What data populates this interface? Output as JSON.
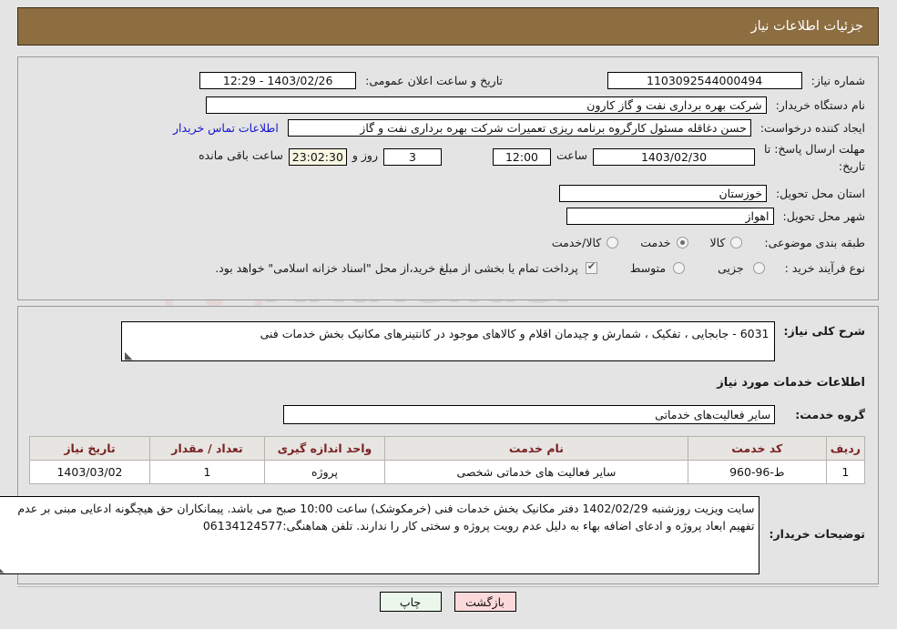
{
  "header": {
    "title": "جزئیات اطلاعات نیاز"
  },
  "form": {
    "need_number_label": "شماره نیاز:",
    "need_number_value": "1103092544000494",
    "announce_label": "تاریخ و ساعت اعلان عمومی:",
    "announce_value": "1403/02/26 - 12:29",
    "buyer_org_label": "نام دستگاه خریدار:",
    "buyer_org_value": "شرکت بهره برداری نفت و گاز کارون",
    "creator_label": "ایجاد کننده درخواست:",
    "creator_value": "حسن دغاقله مسئول کارگروه برنامه ریزی تعمیرات شرکت بهره برداری نفت و گاز",
    "contact_link": "اطلاعات تماس خریدار",
    "deadline_label_line1": "مهلت ارسال پاسخ: تا",
    "deadline_label_line2": "تاریخ:",
    "deadline_date": "1403/02/30",
    "hour_label": "ساعت",
    "deadline_time": "12:00",
    "days_value": "3",
    "days_label": "روز و",
    "remaining_value": "23:02:30",
    "remaining_label": "ساعت باقی مانده",
    "province_label": "استان محل تحویل:",
    "province_value": "خوزستان",
    "city_label": "شهر محل تحویل:",
    "city_value": "اهواز",
    "category_label": "طبقه بندی موضوعی:",
    "category_options": [
      "کالا",
      "خدمت",
      "کالا/خدمت"
    ],
    "category_selected": "خدمت",
    "process_label": "نوع فرآیند خرید :",
    "process_options": [
      "جزیی",
      "متوسط"
    ],
    "process_selected": "جزیی",
    "payment_checkbox_checked": true,
    "payment_note": "پرداخت تمام یا بخشی از مبلغ خرید،از محل \"اسناد خزانه اسلامی\" خواهد بود."
  },
  "description": {
    "label": "شرح کلی نیاز:",
    "value": "6031 - جابجایی ، تفکیک ، شمارش و چیدمان اقلام و کالاهای موجود در کانتینرهای مکانیک بخش خدمات فنی"
  },
  "services": {
    "section_title": "اطلاعات خدمات مورد نیاز",
    "group_label": "گروه خدمت:",
    "group_value": "سایر فعالیت‌های خدماتی",
    "table": {
      "columns": [
        "ردیف",
        "کد خدمت",
        "نام خدمت",
        "واحد اندازه گیری",
        "تعداد / مقدار",
        "تاریخ نیاز"
      ],
      "rows": [
        [
          "1",
          "ط-96-960",
          "سایر فعالیت های خدماتی شخصی",
          "پروژه",
          "1",
          "1403/03/02"
        ]
      ]
    }
  },
  "buyer_notes": {
    "label": "توضیحات خریدار:",
    "value": "سایت ویزیت روزشنبه 1402/02/29 دفتر مکانیک بخش خدمات فنی (خرمکوشک) ساعت 10:00 صبح می باشد. پیمانکاران حق هیچگونه ادعایی مبنی بر عدم تفهیم ابعاد پروژه و ادعای اضافه بهاء به دلیل عدم رویت پروژه و سختی کار را ندارند. تلفن هماهنگی:06134124577"
  },
  "footer": {
    "print_label": "چاپ",
    "back_label": "بازگشت"
  },
  "watermark": {
    "text": "AriaTender",
    "suffix": ".net"
  },
  "colors": {
    "header_bg": "#8d6e41",
    "page_bg": "#e4e4e4",
    "link": "#1414cf",
    "table_header_text": "#7a2222",
    "print_btn": "#eaf7ea",
    "back_btn": "#fbd9da"
  }
}
